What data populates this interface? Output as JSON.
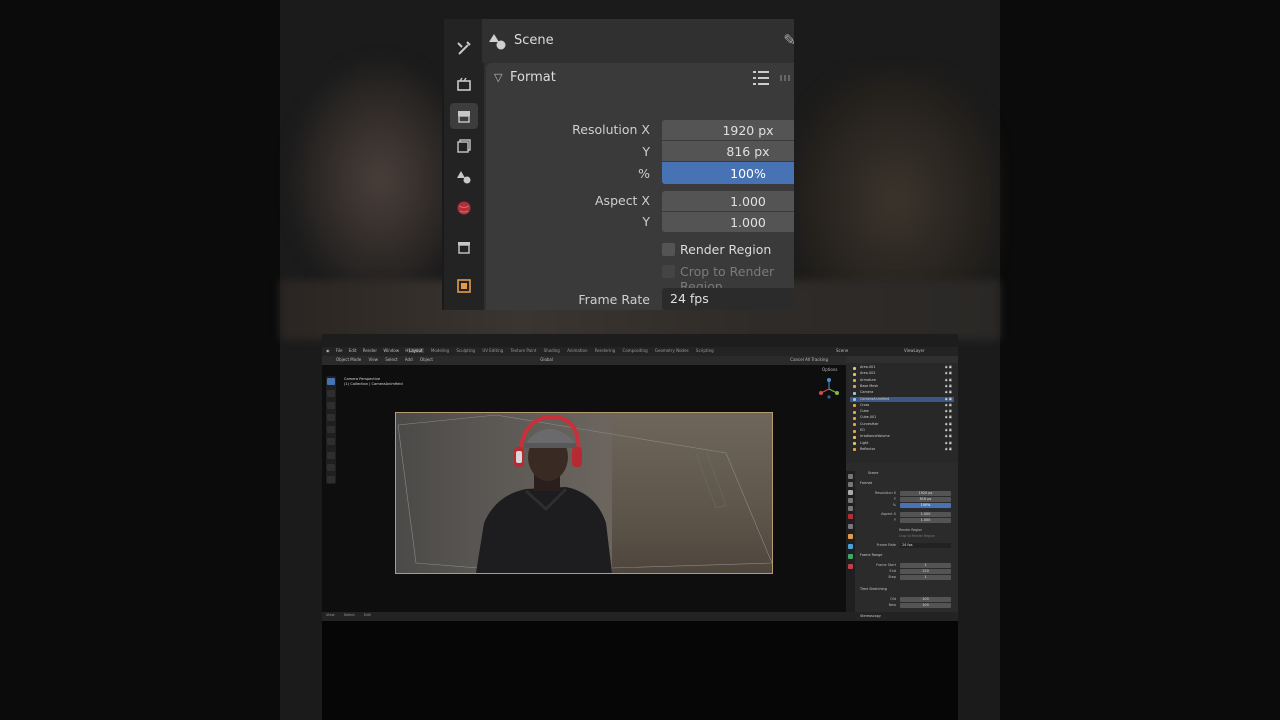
{
  "zoom_panel": {
    "scene_label": "Scene",
    "format_label": "Format",
    "resolution_x_label": "Resolution X",
    "resolution_x": "1920 px",
    "resolution_y_label": "Y",
    "resolution_y": "816 px",
    "percent_label": "%",
    "percent": "100%",
    "aspect_x_label": "Aspect X",
    "aspect_x": "1.000",
    "aspect_y_label": "Y",
    "aspect_y": "1.000",
    "render_region_label": "Render Region",
    "crop_region_label": "Crop to Render Region",
    "frame_rate_label": "Frame Rate",
    "frame_rate": "24 fps"
  },
  "blender": {
    "menus": [
      "File",
      "Edit",
      "Render",
      "Window",
      "Help"
    ],
    "workspaces": [
      "Layout",
      "Modeling",
      "Sculpting",
      "UV Editing",
      "Texture Paint",
      "Shading",
      "Animation",
      "Rendering",
      "Compositing",
      "Geometry Nodes",
      "Scripting"
    ],
    "active_workspace": "Layout",
    "scene_name": "Scene",
    "view_layer": "ViewLayer",
    "header_items": [
      "Object Mode",
      "View",
      "Select",
      "Add",
      "Object"
    ],
    "transform_orientation": "Global",
    "tracking_label": "Cancel All Tracking",
    "options_label": "Options",
    "viewport_info_1": "Camera Perspective",
    "viewport_info_2": "(1) Collection | CameraAnimfield",
    "bottom_items": [
      "View",
      "Select",
      "Edit"
    ],
    "outliner_rows": [
      {
        "name": "Area.001",
        "type": "light"
      },
      {
        "name": "Area.002",
        "type": "light"
      },
      {
        "name": "Armature",
        "type": "obj"
      },
      {
        "name": "Base Mesh",
        "type": "obj"
      },
      {
        "name": "Camera",
        "type": "cam"
      },
      {
        "name": "CameraAnimfield",
        "type": "cam",
        "selected": true
      },
      {
        "name": "Cross",
        "type": "obj"
      },
      {
        "name": "Cube",
        "type": "obj"
      },
      {
        "name": "Cube.001",
        "type": "obj"
      },
      {
        "name": "CurvesHair",
        "type": "obj"
      },
      {
        "name": "EO",
        "type": "obj"
      },
      {
        "name": "IrradianceVolume",
        "type": "light"
      },
      {
        "name": "Light",
        "type": "light"
      },
      {
        "name": "Reflector",
        "type": "obj"
      }
    ],
    "props_scene": "Scene",
    "props_format": "Format",
    "props_res_x_label": "Resolution X",
    "props_res_x": "1920 px",
    "props_res_y_label": "Y",
    "props_res_y": "816 px",
    "props_pct_label": "%",
    "props_pct": "100%",
    "props_aspect_x_label": "Aspect X",
    "props_aspect_x": "1.000",
    "props_aspect_y_label": "Y",
    "props_aspect_y": "1.000",
    "props_render_region": "Render Region",
    "props_crop_region": "Crop to Render Region",
    "props_frame_rate_label": "Frame Rate",
    "props_frame_rate": "24 fps",
    "props_frame_range": "Frame Range",
    "props_frame_start_label": "Frame Start",
    "props_frame_start": "1",
    "props_end_label": "End",
    "props_end": "120",
    "props_step_label": "Step",
    "props_step": "1",
    "props_time_stretching": "Time Stretching",
    "props_old_label": "Old",
    "props_old": "100",
    "props_new_label": "New",
    "props_new": "100",
    "props_stereoscopy": "Stereoscopy"
  },
  "colors": {
    "accent_blue": "#4772b3",
    "panel_bg": "#303030",
    "field_bg": "#545454",
    "camera_border": "#b59b70"
  }
}
